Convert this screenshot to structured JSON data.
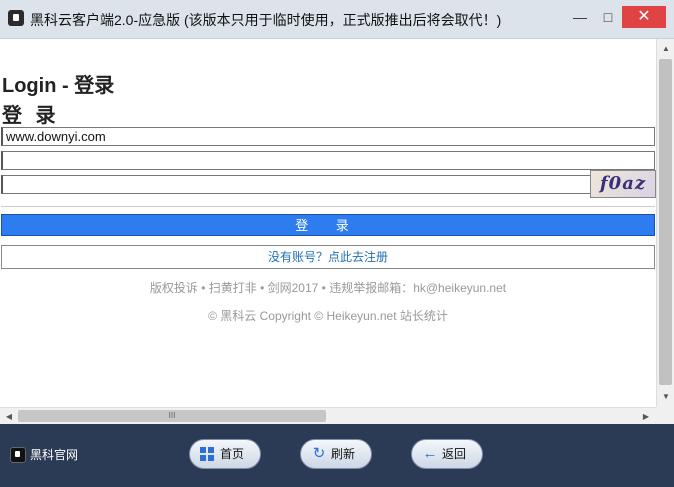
{
  "window": {
    "title": "黑科云客户端2.0-应急版 (该版本只用于临时使用，正式版推出后将会取代！)",
    "minimize": "—",
    "maximize": "□",
    "close": "✕"
  },
  "page": {
    "heading": "Login - 登录",
    "subheading": "登 录",
    "username_value": "www.downyi.com",
    "password_value": "",
    "captcha_value": "",
    "captcha_text": "f0az",
    "login_button": "登  录",
    "register_link": "没有账号？点此去注册",
    "footer_links": "版权投诉 • 扫黄打非 • 剑网2017 • 违规举报邮箱：hk@heikeyun.net",
    "copyright": "© 黑科云 Copyright © Heikeyun.net 站长统计"
  },
  "scrollbars": {
    "up": "▲",
    "down": "▼",
    "left": "◀",
    "right": "▶",
    "hgrip": "III"
  },
  "bottom_bar": {
    "brand": "黑科官网",
    "home": "首页",
    "refresh": "刷新",
    "back": "返回"
  },
  "icons": {
    "app": "app-logo-icon",
    "home": "grid-icon",
    "refresh": "refresh-icon",
    "back": "arrow-left-icon"
  },
  "colors": {
    "login_button": "#2d7df0",
    "close_button": "#e04343",
    "bottom_bar": "#2b3a55",
    "link": "#1f6fb3"
  }
}
